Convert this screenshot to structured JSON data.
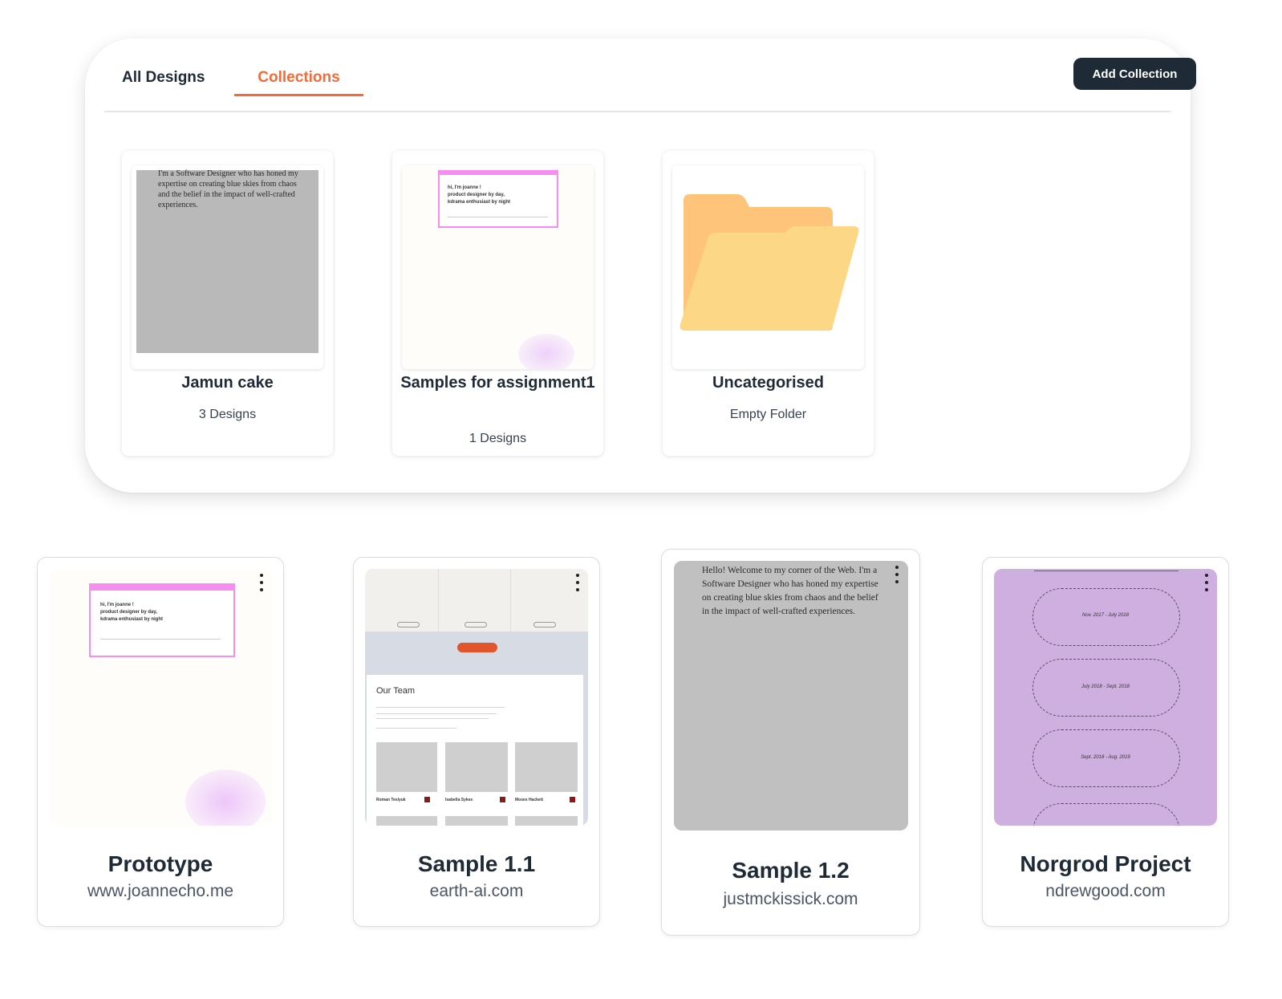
{
  "tabs": {
    "all_designs": "All Designs",
    "collections": "Collections"
  },
  "add_collection_label": "Add Collection",
  "collections": [
    {
      "name": "Jamun cake",
      "count": "3 Designs",
      "preview_text": "I'm a Software Designer who has honed my expertise on creating blue skies from chaos and the belief in the impact of well-crafted experiences."
    },
    {
      "name": "Samples for assignment1",
      "count": "1 Designs",
      "preview": {
        "greeting": "hi, I'm joanne !",
        "line2": "product designer by day,",
        "line3": "kdrama enthusiast by night"
      }
    },
    {
      "name": "Uncategorised",
      "count": "Empty Folder",
      "icon": "folder-icon"
    }
  ],
  "designs": [
    {
      "name": "Prototype",
      "url": "www.joannecho.me",
      "preview": {
        "greeting": "hi, I'm joanne !",
        "line2": "product designer by day,",
        "line3": "kdrama enthusiast by night"
      }
    },
    {
      "name": "Sample 1.1",
      "url": "earth-ai.com",
      "preview": {
        "heading": "Our Team",
        "members": [
          "Roman Teslyuk",
          "Isabella Sykes",
          "Moses Hackett"
        ]
      }
    },
    {
      "name": "Sample 1.2",
      "url": "justmckissick.com",
      "preview_text": "Hello! Welcome to my corner of the Web. I'm a Software Designer who has honed my expertise on creating blue skies from chaos and the belief in the impact of well-crafted experiences."
    },
    {
      "name": "Norgrod Project",
      "url": "ndrewgood.com",
      "preview": {
        "periods": [
          "Nov. 2017 - July 2018",
          "July 2018 - Sept. 2018",
          "Sept. 2018 - Aug. 2019"
        ]
      }
    }
  ],
  "colors": {
    "accent": "#f26b3a",
    "dark": "#1f2a37",
    "preview_gray": "#b9b9b9",
    "preview_purple": "#cfaee0",
    "folder_back": "#fdc47a",
    "folder_front": "#fcd886"
  }
}
